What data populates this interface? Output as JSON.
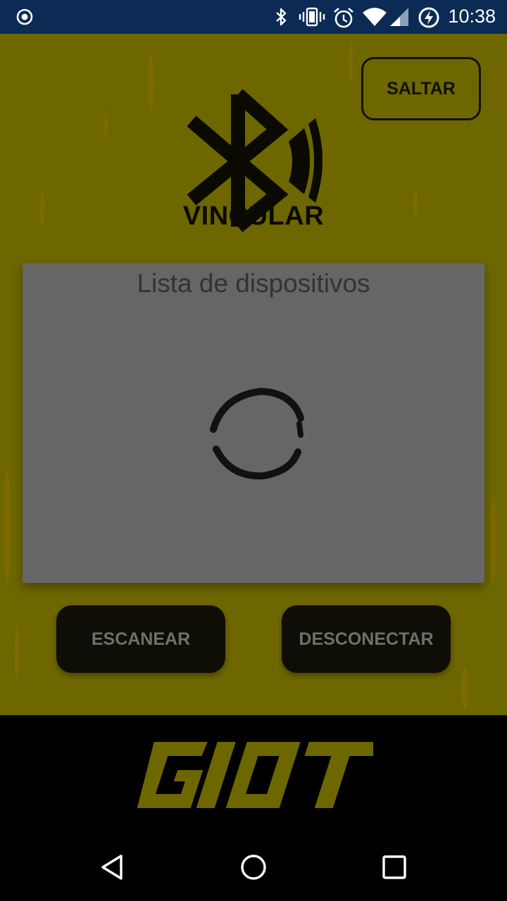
{
  "status_bar": {
    "time": "10:38",
    "left_icon": "record-icon",
    "icons": [
      "bluetooth-icon",
      "vibrate-icon",
      "alarm-icon",
      "wifi-icon",
      "signal-icon",
      "battery-charging-icon"
    ]
  },
  "header": {
    "title": "VINCULAR",
    "icon": "bluetooth-signal-icon",
    "skip_label": "SALTAR"
  },
  "device_list": {
    "title": "Lista de dispositivos",
    "loading": true
  },
  "actions": {
    "scan_label": "ESCANEAR",
    "disconnect_label": "DESCONECTAR"
  },
  "footer": {
    "logo_text": "GIOT"
  },
  "nav_bar": {
    "items": [
      "back-icon",
      "home-icon",
      "recents-icon"
    ]
  },
  "colors": {
    "status_bar": "#0b2b55",
    "background": "#6e6700",
    "panel": "#666666",
    "button": "#0e0d06",
    "logo": "#6e6700"
  }
}
